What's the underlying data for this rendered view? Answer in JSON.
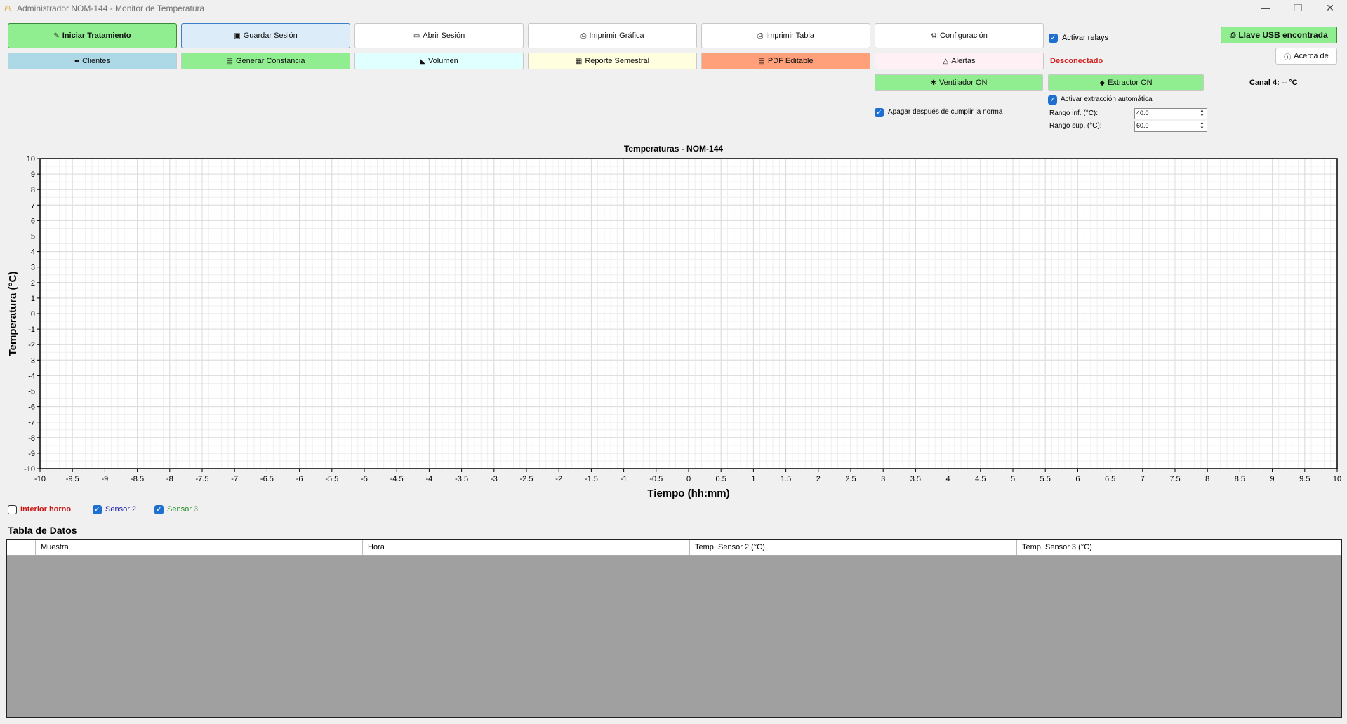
{
  "window": {
    "title": "Administrador NOM-144 - Monitor de Temperatura",
    "controls": {
      "minimize": "—",
      "maximize": "❐",
      "close": "✕"
    }
  },
  "toolbar_row1": [
    {
      "id": "iniciar",
      "label": "Iniciar Tratamiento",
      "icon": "✎",
      "bg": "#90ee90"
    },
    {
      "id": "guardar",
      "label": "Guardar Sesión",
      "icon": "▣",
      "bg": "#dcecf8"
    },
    {
      "id": "abrir",
      "label": "Abrir Sesión",
      "icon": "▭",
      "bg": "#ffffff"
    },
    {
      "id": "imprimir-grafica",
      "label": "Imprimir Gráfica",
      "icon": "⎙",
      "bg": "#ffffff"
    },
    {
      "id": "imprimir-tabla",
      "label": "Imprimir Tabla",
      "icon": "⎙",
      "bg": "#ffffff"
    },
    {
      "id": "configuracion",
      "label": "Configuración",
      "icon": "⚙",
      "bg": "#ffffff"
    }
  ],
  "toolbar_row2": [
    {
      "id": "clientes",
      "label": "Clientes",
      "icon": "▪▪",
      "bg": "#add8e6"
    },
    {
      "id": "constancia",
      "label": "Generar Constancia",
      "icon": "▤",
      "bg": "#90ee90"
    },
    {
      "id": "volumen",
      "label": "Volumen",
      "icon": "◣",
      "bg": "#e0ffff"
    },
    {
      "id": "reporte",
      "label": "Reporte Semestral",
      "icon": "▦",
      "bg": "#ffffe0"
    },
    {
      "id": "pdf",
      "label": "PDF Editable",
      "icon": "▤",
      "bg": "#ffa07a"
    },
    {
      "id": "alertas",
      "label": "Alertas",
      "icon": "△",
      "bg": "#fff0f5"
    }
  ],
  "relays": {
    "label": "Activar relays",
    "checked": true
  },
  "usb": {
    "label": "Llave USB encontrada",
    "icon": "⎙",
    "bg": "#90ee90"
  },
  "about": {
    "label": "Acerca de",
    "icon": "ⓘ"
  },
  "status": {
    "text": "Desconectado",
    "color": "#d42020"
  },
  "canal4": {
    "text": "Canal 4: -- °C"
  },
  "ventilador": {
    "label": "Ventilador ON",
    "icon": "✱",
    "bg": "#90ee90"
  },
  "extractor": {
    "label": "Extractor ON",
    "icon": "◆",
    "bg": "#90ee90"
  },
  "auto_extract": {
    "label": "Activar extracción automática",
    "checked": true
  },
  "apagar": {
    "label": "Apagar después de cumplir la norma",
    "checked": true
  },
  "rango_inf": {
    "label": "Rango inf. (°C):",
    "value": "40.0"
  },
  "rango_sup": {
    "label": "Rango sup. (°C):",
    "value": "60.0"
  },
  "chart_data": {
    "type": "line",
    "title": "Temperaturas - NOM-144",
    "xlabel": "Tiempo (hh:mm)",
    "ylabel": "Temperatura (°C)",
    "xlim": [
      -10,
      10
    ],
    "ylim": [
      -10,
      10
    ],
    "x_major_step": 0.5,
    "y_major_step": 1,
    "grid": true,
    "series": []
  },
  "legend": [
    {
      "id": "interior",
      "label": "Interior horno",
      "checked": false,
      "color": "#cc1111"
    },
    {
      "id": "sensor2",
      "label": "Sensor 2",
      "checked": true,
      "color": "#1a1aa8"
    },
    {
      "id": "sensor3",
      "label": "Sensor 3",
      "checked": true,
      "color": "#1e8a1e"
    }
  ],
  "table": {
    "title": "Tabla de Datos",
    "columns": [
      "Muestra",
      "Hora",
      "Temp. Sensor 2 (°C)",
      "Temp. Sensor 3 (°C)"
    ],
    "rows": []
  }
}
